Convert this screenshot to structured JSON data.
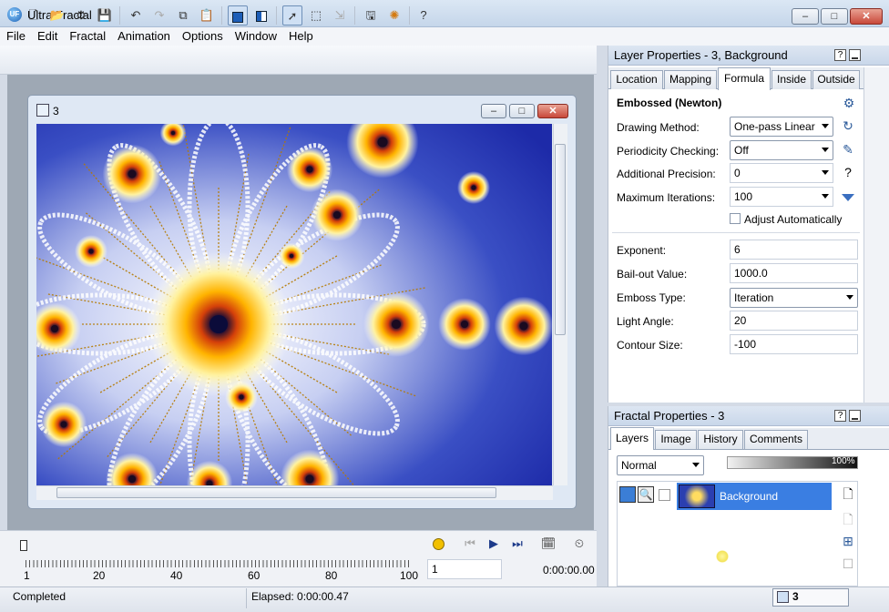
{
  "window": {
    "title": "Ultra Fractal",
    "app_icon": "UF",
    "minimize": "–",
    "maximize": "□",
    "close": "✕"
  },
  "menu": [
    "File",
    "Edit",
    "Fractal",
    "Animation",
    "Options",
    "Window",
    "Help"
  ],
  "toolbar": {
    "help": "?"
  },
  "child_window": {
    "title": "3"
  },
  "layer_properties": {
    "title": "Layer Properties - 3, Background",
    "tabs": [
      "Location",
      "Mapping",
      "Formula",
      "Inside",
      "Outside"
    ],
    "formula_name": "Embossed (Newton)",
    "rows": [
      {
        "label": "Drawing Method:",
        "value": "One-pass Linear"
      },
      {
        "label": "Periodicity Checking:",
        "value": "Off"
      },
      {
        "label": "Additional Precision:",
        "value": "0"
      },
      {
        "label": "Maximum Iterations:",
        "value": "100"
      }
    ],
    "adjust_auto": "Adjust Automatically",
    "params": [
      {
        "label": "Exponent:",
        "value": "6"
      },
      {
        "label": "Bail-out Value:",
        "value": "1000.0"
      },
      {
        "label": "Emboss Type:",
        "value": "Iteration"
      },
      {
        "label": "Light Angle:",
        "value": "20"
      },
      {
        "label": "Contour Size:",
        "value": "-100"
      }
    ],
    "help_icon": "?"
  },
  "fractal_properties": {
    "title": "Fractal Properties - 3",
    "tabs": [
      "Layers",
      "Image",
      "History",
      "Comments"
    ],
    "merge_mode": "Normal",
    "opacity": "100%",
    "opacity_fraction": 1.0,
    "layer_name": "Background"
  },
  "timeline": {
    "ticks": [
      "1",
      "20",
      "40",
      "60",
      "80",
      "100"
    ],
    "frame": "1",
    "time": "0:00:00.00"
  },
  "status": {
    "left": "Completed",
    "elapsed": "Elapsed: 0:00:00.47",
    "doc": "3"
  }
}
